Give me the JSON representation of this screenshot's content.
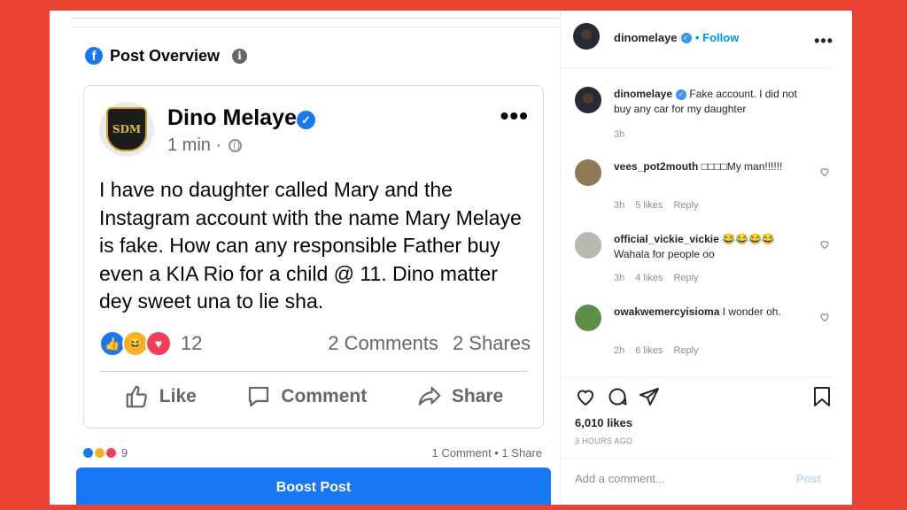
{
  "facebook": {
    "panel_title": "Post Overview",
    "logo_letter": "f",
    "info_icon": "i",
    "post": {
      "page_logo_text": "SDM",
      "author": "Dino Melaye",
      "time": "1 min ·",
      "text": "I have no daughter called Mary and the Instagram account with the name Mary Melaye is fake. How can any responsible Father buy even a KIA Rio for a child @ 11. Dino matter dey sweet una to lie sha.",
      "reaction_count": "12",
      "comments": "2 Comments",
      "shares": "2 Shares",
      "actions": {
        "like": "Like",
        "comment": "Comment",
        "share": "Share"
      }
    },
    "summary": {
      "reaction_count": "9",
      "stats": "1 Comment • 1 Share"
    },
    "boost_label": "Boost Post"
  },
  "instagram": {
    "header": {
      "username": "dinomelaye",
      "follow_label": "• Follow"
    },
    "caption": {
      "username": "dinomelaye",
      "text": "Fake account. I did not buy any car for my daughter",
      "time": "3h"
    },
    "comments": [
      {
        "username": "vees_pot2mouth",
        "text": "□□□□My man!!!!!!",
        "time": "3h",
        "likes": "5 likes",
        "reply": "Reply"
      },
      {
        "username": "official_vickie_vickie",
        "text": "😂😂😂😂 Wahala for people oo",
        "time": "3h",
        "likes": "4 likes",
        "reply": "Reply"
      },
      {
        "username": "owakwemercyisioma",
        "text": "I wonder oh.",
        "time": "2h",
        "likes": "6 likes",
        "reply": "Reply"
      }
    ],
    "likes": "6,010 likes",
    "posted_ago": "3 HOURS AGO",
    "add_comment_placeholder": "Add a comment...",
    "post_label": "Post"
  },
  "colors": {
    "background": "#ea4335",
    "facebook_blue": "#1877f2",
    "instagram_link": "#0095f6"
  }
}
